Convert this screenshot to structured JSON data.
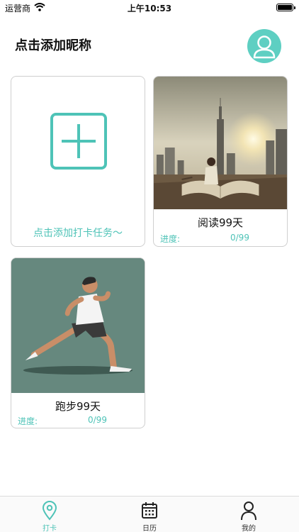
{
  "status_bar": {
    "carrier": "运营商",
    "time": "上午10:53"
  },
  "header": {
    "title": "点击添加昵称",
    "avatar_icon": "user-avatar-icon"
  },
  "add_card": {
    "label": "点击添加打卡任务～",
    "icon": "plus-square-icon"
  },
  "tasks": [
    {
      "title": "阅读99天",
      "progress_label": "进度:",
      "progress_value": "0/99"
    },
    {
      "title": "跑步99天",
      "progress_label": "进度:",
      "progress_value": "0/99"
    }
  ],
  "tab_bar": {
    "items": [
      {
        "label": "打卡",
        "icon": "location-pin-icon",
        "active": true
      },
      {
        "label": "日历",
        "icon": "calendar-icon",
        "active": false
      },
      {
        "label": "我的",
        "icon": "person-icon",
        "active": false
      }
    ]
  },
  "colors": {
    "accent": "#4ec3b7",
    "avatar_bg": "#5ecfc2",
    "running_bg": "#66887e"
  }
}
